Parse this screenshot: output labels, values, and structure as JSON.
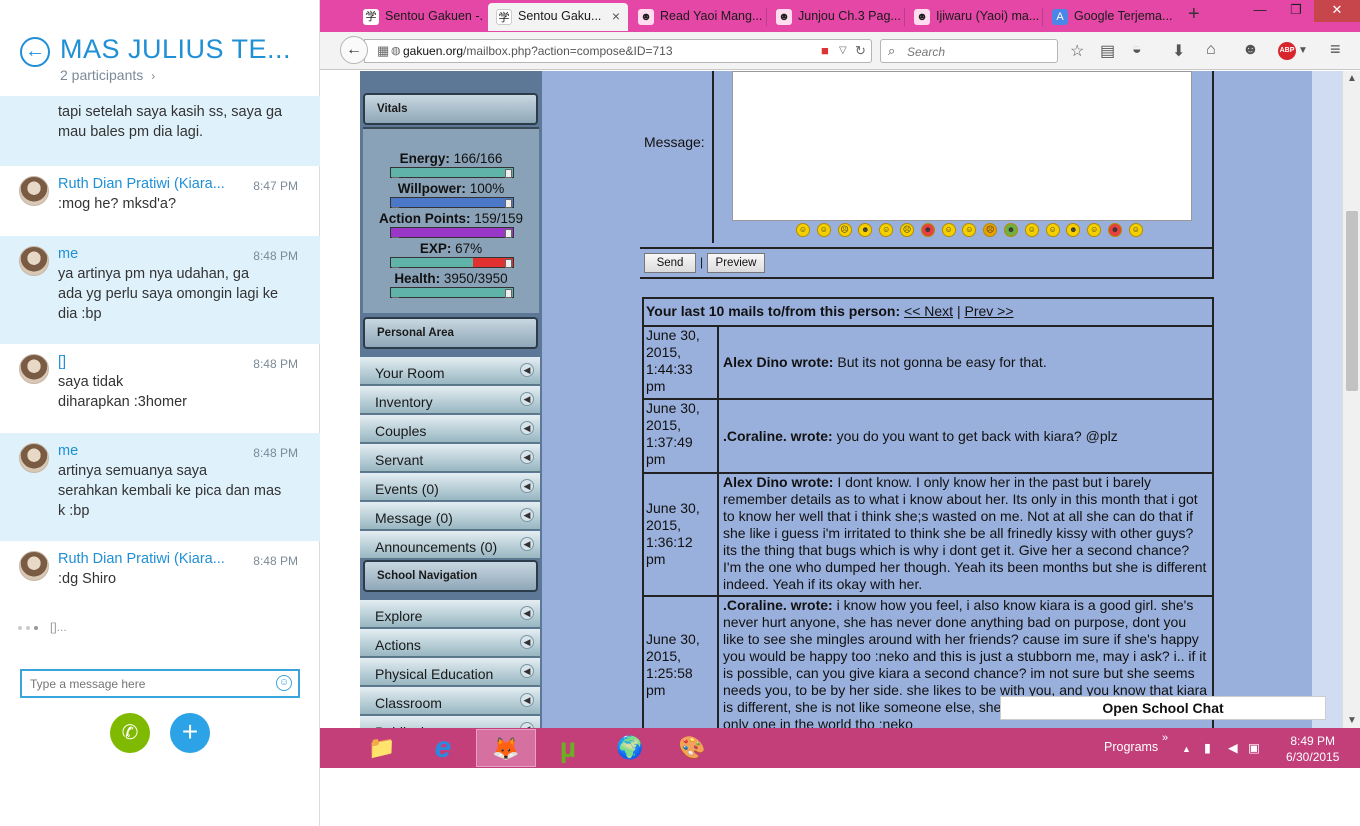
{
  "skype": {
    "title": "MAS JULIUS TE...",
    "participants": "2 participants",
    "participants_chev": "›",
    "back_icon": "←",
    "messages": [
      {
        "name": "",
        "time": "",
        "lines": [
          "tapi setelah saya kasih ss, saya ga",
          "mau bales pm dia lagi."
        ],
        "style": "blue"
      },
      {
        "name": "Ruth Dian Pratiwi (Kiara...",
        "time": "8:47 PM",
        "lines": [
          ":mog he? mksd'a?"
        ],
        "style": "white"
      },
      {
        "name": "me",
        "time": "8:48 PM",
        "lines": [
          "ya artinya pm nya udahan, ga",
          "ada yg perlu saya omongin lagi ke",
          "dia :bp"
        ],
        "style": "blue"
      },
      {
        "name": "[]",
        "time": "8:48 PM",
        "lines": [
          "saya tidak",
          "diharapkan :3homer"
        ],
        "style": "white"
      },
      {
        "name": "me",
        "time": "8:48 PM",
        "lines": [
          "artinya semuanya saya",
          "serahkan kembali ke pica dan mas",
          "k :bp"
        ],
        "style": "blue"
      },
      {
        "name": "Ruth Dian Pratiwi (Kiara...",
        "time": "8:48 PM",
        "lines": [
          ":dg Shiro"
        ],
        "style": "white"
      }
    ],
    "typing_text": "[]...",
    "compose_placeholder": "Type a message here",
    "smiley_icon": "☺",
    "call_icon": "✆",
    "add_icon": "+"
  },
  "browser": {
    "tabs": [
      {
        "label": "Sentou Gakuen -...",
        "icon": "学"
      },
      {
        "label": "Sentou Gaku...",
        "icon": "学",
        "active": true
      },
      {
        "label": "Read Yaoi Mang...",
        "icon": "☻"
      },
      {
        "label": "Junjou Ch.3 Pag...",
        "icon": "☻"
      },
      {
        "label": "Ijiwaru (Yaoi) ma...",
        "icon": "☻"
      },
      {
        "label": "Google Terjema...",
        "icon": "A"
      }
    ],
    "tab_close": "×",
    "new_tab": "+",
    "win_min": "—",
    "win_max": "❐",
    "win_close": "✕",
    "url_domain": "gakuen.org",
    "url_path": "/mailbox.php?action=compose&ID=713",
    "search_placeholder": "Search",
    "abp": "ABP"
  },
  "sidebar": {
    "vitals_header": "Vitals",
    "vitals": [
      {
        "label": "Energy:",
        "value": "166/166",
        "fill": 1.0,
        "color": "#5fb3a8"
      },
      {
        "label": "Willpower:",
        "value": "100%",
        "fill": 1.0,
        "color": "#4b78c8"
      },
      {
        "label": "Action Points:",
        "value": "159/159",
        "fill": 1.0,
        "color": "#9a36c8"
      },
      {
        "label": "EXP:",
        "value": "67%",
        "fill": 0.67,
        "color": "#5fb3a8",
        "rest": "#e03030"
      },
      {
        "label": "Health:",
        "value": "3950/3950",
        "fill": 1.0,
        "color": "#5fb3a8"
      }
    ],
    "personal_header": "Personal Area",
    "personal_items": [
      "Your Room",
      "Inventory",
      "Couples",
      "Servant",
      "Events (0)",
      "Message (0)",
      "Announcements (0)"
    ],
    "school_header": "School Navigation",
    "school_items": [
      "Explore",
      "Actions",
      "Physical Education",
      "Classroom",
      "Public .l..."
    ]
  },
  "form": {
    "message_label": "Message:",
    "send": "Send",
    "preview": "Preview",
    "separator": "|"
  },
  "mails": {
    "header_bold": "Your last 10 mails to/from this person:",
    "next": "<< Next",
    "sep": "|",
    "prev": "Prev >>",
    "rows": [
      {
        "date": [
          "June 30,",
          "2015,",
          "1:44:33",
          "pm"
        ],
        "author": "Alex Dino wrote:",
        "text": " But its not gonna be easy for that."
      },
      {
        "date": [
          "June 30,",
          "2015,",
          "1:37:49",
          "pm"
        ],
        "author": ".Coraline. wrote:",
        "text": " you do you want to get back with kiara? @plz"
      },
      {
        "date": [
          "June 30,",
          "2015,",
          "1:36:12",
          "pm"
        ],
        "author": "Alex Dino wrote:",
        "text": " I dont know. I only know her in the past but i barely remember details as to what i know about her. Its only in this month that i got to know her well that i think she;s wasted on me. Not at all she can do that if she like i guess i'm irritated to think she be all frinedly kissy with other guys? its the thing that bugs which is why i dont get it. Give her a second chance? I'm the one who dumped her though. Yeah its been months but she is different indeed. Yeah if its okay with her."
      },
      {
        "date": [
          "June 30,",
          "2015,",
          "1:25:58",
          "pm"
        ],
        "author": ".Coraline. wrote:",
        "text": " i know how you feel, i also know kiara is a good girl. she's never hurt anyone, she has never done anything bad on purpose, dont you like to see she mingles around with her friends? cause im sure if she's happy you would be happy too :neko and this is just a stubborn me, may i ask? i.. if it is possible, can you give kiara a second chance? im not sure but she seems needs you, to be by her side. she likes to be with you, and you know that kiara is different, she is not like someone else, she is someone who kiara, she is only one in the world tho :neko"
      }
    ],
    "chat_button": "Open School Chat"
  },
  "taskbar": {
    "items": [
      {
        "icon": "📁",
        "name": "file-explorer"
      },
      {
        "icon": "e",
        "name": "internet-explorer"
      },
      {
        "icon": "🦊",
        "name": "firefox"
      },
      {
        "icon": "µ",
        "name": "utorrent"
      },
      {
        "icon": "🌍",
        "name": "network"
      },
      {
        "icon": "🎨",
        "name": "paint"
      }
    ],
    "programs": "Programs",
    "programs_chev": "»",
    "tray_up": "▲",
    "time": "8:49 PM",
    "date": "6/30/2015"
  }
}
